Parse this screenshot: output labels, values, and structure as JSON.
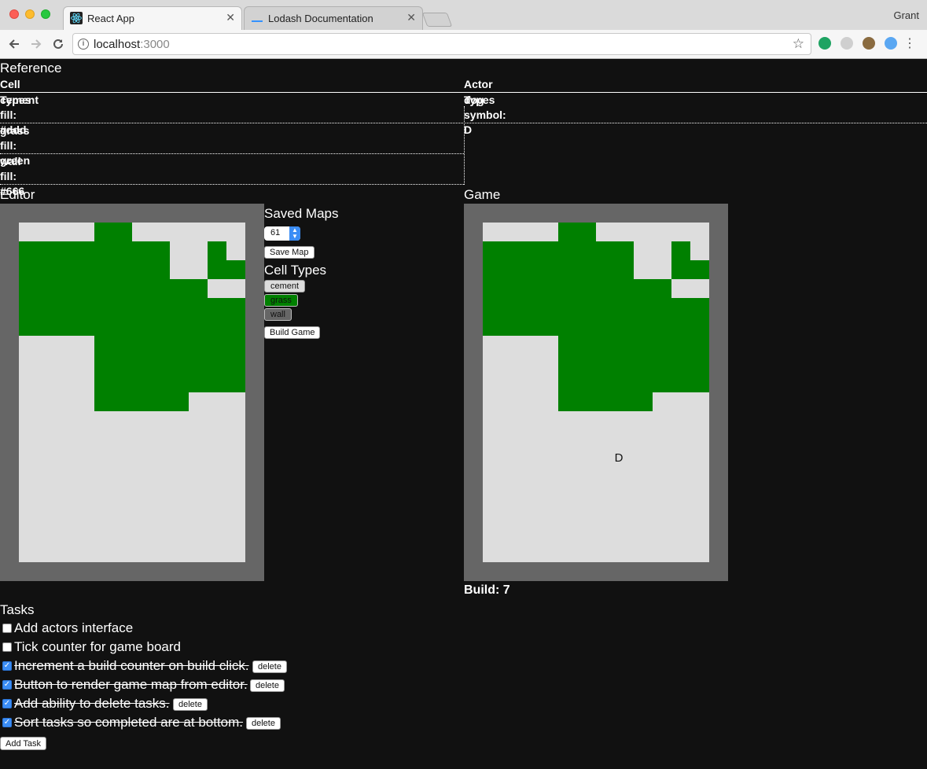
{
  "browser": {
    "tabs": [
      {
        "title": "React App",
        "icon": "react-icon",
        "active": true
      },
      {
        "title": "Lodash Documentation",
        "icon": "lodash-icon",
        "active": false
      }
    ],
    "profile": "Grant",
    "url_host": "localhost",
    "url_port": ":3000",
    "close_glyph": "✕"
  },
  "reference": {
    "title": "Reference",
    "cell_types_header": "Cell Types",
    "actor_types_header": "Actor Types",
    "cell_types": [
      {
        "name": "cement",
        "detail": "fill: #ddd"
      },
      {
        "name": "grass",
        "detail": "fill: green"
      },
      {
        "name": "wall",
        "detail": "fill: #666"
      }
    ],
    "actor_types": [
      {
        "name": "dog",
        "detail": "symbol: D"
      }
    ]
  },
  "editor": {
    "title": "Editor",
    "saved_maps_title": "Saved Maps",
    "selected_map": "61",
    "save_map_label": "Save Map",
    "cell_types_title": "Cell Types",
    "cell_type_buttons": [
      "cement",
      "grass",
      "wall"
    ],
    "build_game_label": "Build Game"
  },
  "game": {
    "title": "Game",
    "build_label": "Build: 7",
    "actor_symbol": "D"
  },
  "map": {
    "cols": 12,
    "rows": 18,
    "colors": {
      "cement": "#dddddd",
      "grass": "#008000",
      "wall": "#666666"
    },
    "grass_rows": [
      [
        4,
        5
      ],
      [
        0,
        7
      ],
      [
        10
      ],
      [
        0,
        7
      ],
      [
        10,
        11
      ],
      [
        0,
        9
      ],
      [
        0,
        11
      ],
      [
        0,
        11
      ],
      [
        4,
        11
      ],
      [
        4,
        11
      ],
      [
        4,
        11
      ],
      [
        4,
        8
      ]
    ]
  },
  "tasks": {
    "title": "Tasks",
    "items": [
      {
        "text": "Add actors interface",
        "done": false
      },
      {
        "text": "Tick counter for game board",
        "done": false
      },
      {
        "text": "Increment a build counter on build click.",
        "done": true
      },
      {
        "text": "Button to render game map from editor.",
        "done": true
      },
      {
        "text": "Add ability to delete tasks.",
        "done": true
      },
      {
        "text": "Sort tasks so completed are at bottom.",
        "done": true
      }
    ],
    "delete_label": "delete",
    "add_task_label": "Add Task"
  }
}
